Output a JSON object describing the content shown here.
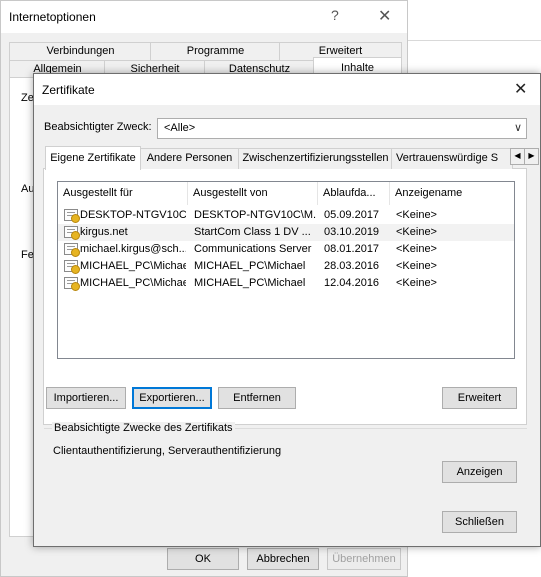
{
  "parent_window": {
    "title": "Internetoptionen",
    "help_glyph": "?",
    "close_glyph": "✕",
    "tabs_row1": [
      "Verbindungen",
      "Programme",
      "Erweitert"
    ],
    "tabs_row2": [
      "Allgemein",
      "Sicherheit",
      "Datenschutz",
      "Inhalte"
    ],
    "active_tab": "Inhalte",
    "hidden_fragments": [
      "Ze",
      "Au",
      "Fe"
    ],
    "buttons": {
      "ok": "OK",
      "cancel": "Abbrechen",
      "apply": "Übernehmen"
    }
  },
  "dialog": {
    "title": "Zertifikate",
    "close_glyph": "✕",
    "purpose_label": "Beabsichtigter Zweck:",
    "purpose_value": "<Alle>",
    "tabs": [
      "Eigene Zertifikate",
      "Andere Personen",
      "Zwischenzertifizierungsstellen",
      "Vertrauenswürdige S"
    ],
    "active_tab": "Eigene Zertifikate",
    "columns": [
      "Ausgestellt für",
      "Ausgestellt von",
      "Ablaufda...",
      "Anzeigename"
    ],
    "rows": [
      {
        "issued_to": "DESKTOP-NTGV10C...",
        "issued_by": "DESKTOP-NTGV10C\\M...",
        "expires": "05.09.2017",
        "display_name": "<Keine>",
        "selected": false
      },
      {
        "issued_to": "kirgus.net",
        "issued_by": "StartCom Class 1 DV ...",
        "expires": "03.10.2019",
        "display_name": "<Keine>",
        "selected": true
      },
      {
        "issued_to": "michael.kirgus@sch...",
        "issued_by": "Communications Server",
        "expires": "08.01.2017",
        "display_name": "<Keine>",
        "selected": false
      },
      {
        "issued_to": "MICHAEL_PC\\Michael",
        "issued_by": "MICHAEL_PC\\Michael",
        "expires": "28.03.2016",
        "display_name": "<Keine>",
        "selected": false
      },
      {
        "issued_to": "MICHAEL_PC\\Michael",
        "issued_by": "MICHAEL_PC\\Michael",
        "expires": "12.04.2016",
        "display_name": "<Keine>",
        "selected": false
      }
    ],
    "buttons": {
      "import": "Importieren...",
      "export": "Exportieren...",
      "remove": "Entfernen",
      "advanced": "Erweitert",
      "view": "Anzeigen",
      "close": "Schließen"
    },
    "purposes_title": "Beabsichtigte Zwecke des Zertifikats",
    "purposes_text": "Clientauthentifizierung, Serverauthentifizierung"
  },
  "colors": {
    "focus": "#0078d7",
    "window_bg": "#f0f0f0",
    "selection": "#f2f2f2"
  }
}
